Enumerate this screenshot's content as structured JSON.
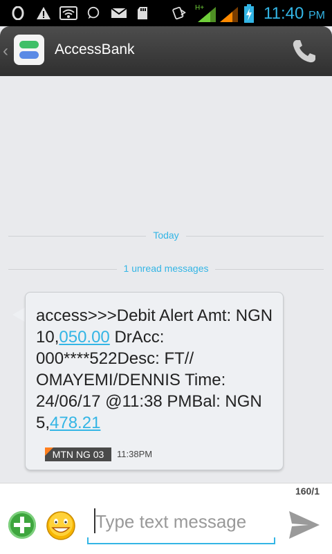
{
  "status_bar": {
    "time": "11:40",
    "ampm": "PM",
    "network": "H+",
    "icons": [
      "opera-icon",
      "warning-icon",
      "wifi-icon",
      "whatsapp-icon",
      "mail-icon",
      "sd-card-icon",
      "data-transfer-icon",
      "signal-icon",
      "signal-icon",
      "battery-charging-icon"
    ]
  },
  "header": {
    "title": "AccessBank",
    "accent": "#33b5e5"
  },
  "conversation": {
    "date_divider": "Today",
    "unread_divider": "1 unread messages",
    "message": {
      "part1": "access>>>Debit Alert Amt: NGN 10,",
      "link1": "050.00",
      "part2": " DrAcc: 000****522Desc: FT// OMAYEMI/DENNIS Time: 24/06/17 @11:38 PMBal: NGN 5,",
      "link2": "478.21",
      "sim_label": "MTN NG 03",
      "time": "11:38PM"
    }
  },
  "compose": {
    "counter": "160/1",
    "placeholder": "Type text message"
  }
}
